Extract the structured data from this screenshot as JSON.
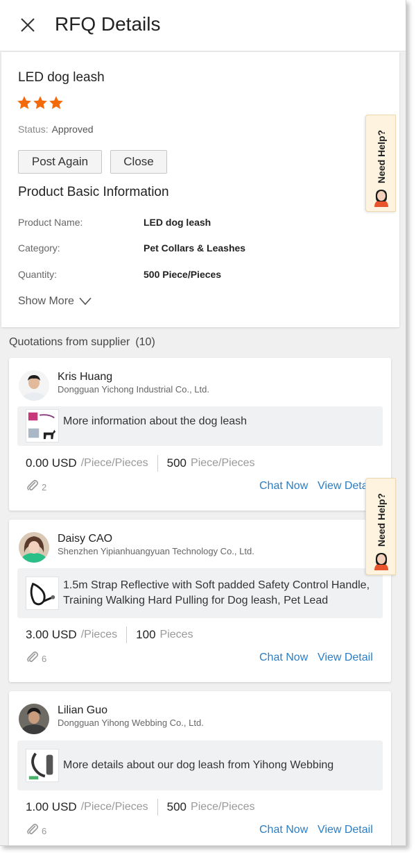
{
  "header": {
    "title": "RFQ Details"
  },
  "rfq": {
    "product_title": "LED dog leash",
    "rating_stars": 3,
    "status_label": "Status:",
    "status_value": "Approved",
    "buttons": {
      "post_again": "Post Again",
      "close": "Close"
    },
    "section_title": "Product Basic Information",
    "info": [
      {
        "label": "Product Name:",
        "value": "LED dog leash"
      },
      {
        "label": "Category:",
        "value": "Pet Collars & Leashes"
      },
      {
        "label": "Quantity:",
        "value": "500 Piece/Pieces"
      }
    ],
    "show_more": "Show More"
  },
  "quotations": {
    "heading": "Quotations from supplier",
    "count": "(10)",
    "items": [
      {
        "name": "Kris Huang",
        "company": "Dongguan Yichong Industrial Co., Ltd.",
        "message": "More information about the dog leash",
        "price": "0.00 USD",
        "price_unit": "/Piece/Pieces",
        "qty": "500",
        "qty_unit": "Piece/Pieces",
        "attachments": "2",
        "chat": "Chat Now",
        "view": "View Detail"
      },
      {
        "name": "Daisy CAO",
        "company": "Shenzhen Yipianhuangyuan Technology Co., Ltd.",
        "message": "1.5m Strap Reflective with Soft padded Safety Control Handle, Training Walking Hard Pulling for Dog leash, Pet Lead",
        "price": "3.00 USD",
        "price_unit": "/Pieces",
        "qty": "100",
        "qty_unit": "Pieces",
        "attachments": "6",
        "chat": "Chat Now",
        "view": "View Detail"
      },
      {
        "name": "Lilian Guo",
        "company": "Dongguan Yihong Webbing Co., Ltd.",
        "message": "More details about our dog leash from Yihong Webbing",
        "price": "1.00 USD",
        "price_unit": "/Piece/Pieces",
        "qty": "500",
        "qty_unit": "Piece/Pieces",
        "attachments": "6",
        "chat": "Chat Now",
        "view": "View Detail"
      }
    ]
  },
  "help": {
    "label": "Need Help?"
  },
  "colors": {
    "star": "#f26a0a",
    "link": "#2a7dc4",
    "help_bg": "#fdf3df"
  }
}
